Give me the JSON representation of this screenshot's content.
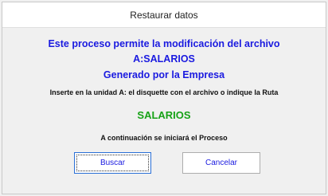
{
  "window": {
    "title": "Restaurar datos"
  },
  "message": {
    "line1": "Este proceso permite la modificación del archivo",
    "line2": "A:SALARIOS",
    "line3": "Generado por la Empresa",
    "instruction": "Inserte en la unidad A:  el disquette con el archivo o indique la Ruta",
    "file_name": "SALARIOS",
    "process_note": "A continuación se iniciará el Proceso"
  },
  "buttons": {
    "search": "Buscar",
    "cancel": "Cancelar"
  },
  "colors": {
    "accent_text": "#1a1ae0",
    "file_name": "#17a217"
  }
}
